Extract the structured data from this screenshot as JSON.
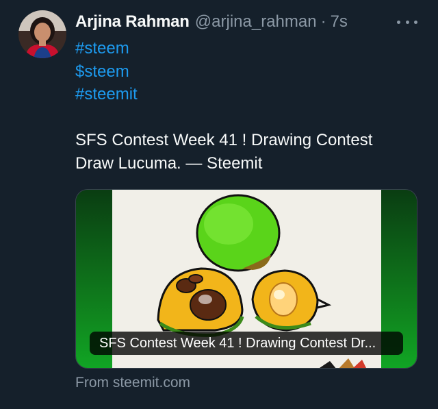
{
  "author": {
    "name": "Arjina Rahman",
    "handle": "@arjina_rahman",
    "separator": "·",
    "time": "7s",
    "avatar_icon": "profile-photo"
  },
  "more_icon": "more-horizontal-icon",
  "tags": [
    "#steem",
    "$steem",
    "#steemit"
  ],
  "body": {
    "line1": "SFS Contest Week 41 ! Drawing Contest",
    "line2": "Draw Lucuma. — Steemit"
  },
  "card": {
    "title": "SFS Contest Week 41 ! Drawing Contest Dr...",
    "image_icon": "lucuma-drawing-image"
  },
  "source": "From steemit.com",
  "colors": {
    "background": "#15202b",
    "link": "#1d9bf0",
    "text": "#f7f9f9",
    "muted": "#8b98a5"
  }
}
